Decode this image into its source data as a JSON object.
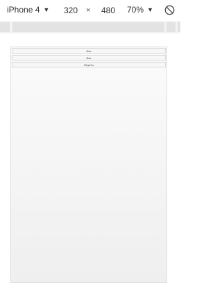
{
  "toolbar": {
    "device": "iPhone 4",
    "width": "320",
    "times": "×",
    "height": "480",
    "zoom": "70%"
  },
  "page": {
    "rows": [
      "Nav",
      "Nav",
      "Rhythm"
    ]
  }
}
